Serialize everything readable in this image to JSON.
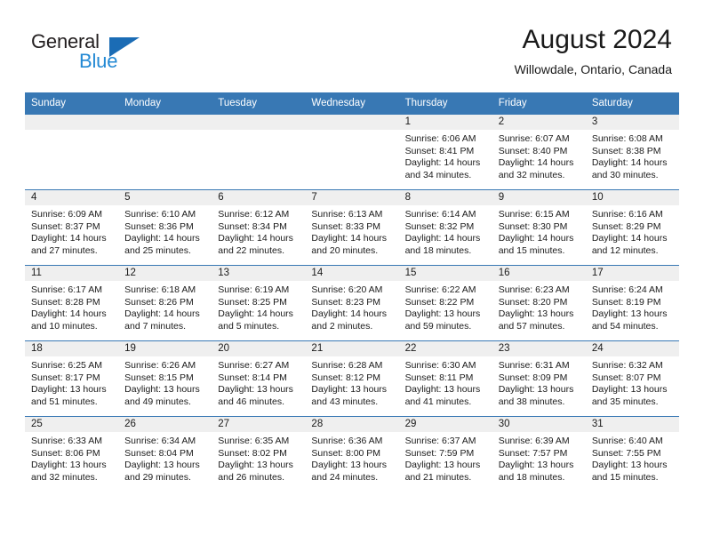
{
  "brand": {
    "name_top": "General",
    "name_bottom": "Blue",
    "triangle_color": "#1b6cb5",
    "blue_text_color": "#2389d4"
  },
  "header": {
    "title": "August 2024",
    "subtitle": "Willowdale, Ontario, Canada",
    "header_bg": "#3878b4",
    "header_text": "#ffffff"
  },
  "weekdays": [
    "Sunday",
    "Monday",
    "Tuesday",
    "Wednesday",
    "Thursday",
    "Friday",
    "Saturday"
  ],
  "labels": {
    "sunrise_prefix": "Sunrise:",
    "sunset_prefix": "Sunset:",
    "daylight_prefix": "Daylight:"
  },
  "weeks": [
    [
      {
        "day": "",
        "empty": true,
        "line1": "",
        "line2": "",
        "line3": "",
        "line4": ""
      },
      {
        "day": "",
        "empty": true,
        "line1": "",
        "line2": "",
        "line3": "",
        "line4": ""
      },
      {
        "day": "",
        "empty": true,
        "line1": "",
        "line2": "",
        "line3": "",
        "line4": ""
      },
      {
        "day": "",
        "empty": true,
        "line1": "",
        "line2": "",
        "line3": "",
        "line4": ""
      },
      {
        "day": "1",
        "empty": false,
        "line1": "Sunrise: 6:06 AM",
        "line2": "Sunset: 8:41 PM",
        "line3": "Daylight: 14 hours",
        "line4": "and 34 minutes."
      },
      {
        "day": "2",
        "empty": false,
        "line1": "Sunrise: 6:07 AM",
        "line2": "Sunset: 8:40 PM",
        "line3": "Daylight: 14 hours",
        "line4": "and 32 minutes."
      },
      {
        "day": "3",
        "empty": false,
        "line1": "Sunrise: 6:08 AM",
        "line2": "Sunset: 8:38 PM",
        "line3": "Daylight: 14 hours",
        "line4": "and 30 minutes."
      }
    ],
    [
      {
        "day": "4",
        "empty": false,
        "line1": "Sunrise: 6:09 AM",
        "line2": "Sunset: 8:37 PM",
        "line3": "Daylight: 14 hours",
        "line4": "and 27 minutes."
      },
      {
        "day": "5",
        "empty": false,
        "line1": "Sunrise: 6:10 AM",
        "line2": "Sunset: 8:36 PM",
        "line3": "Daylight: 14 hours",
        "line4": "and 25 minutes."
      },
      {
        "day": "6",
        "empty": false,
        "line1": "Sunrise: 6:12 AM",
        "line2": "Sunset: 8:34 PM",
        "line3": "Daylight: 14 hours",
        "line4": "and 22 minutes."
      },
      {
        "day": "7",
        "empty": false,
        "line1": "Sunrise: 6:13 AM",
        "line2": "Sunset: 8:33 PM",
        "line3": "Daylight: 14 hours",
        "line4": "and 20 minutes."
      },
      {
        "day": "8",
        "empty": false,
        "line1": "Sunrise: 6:14 AM",
        "line2": "Sunset: 8:32 PM",
        "line3": "Daylight: 14 hours",
        "line4": "and 18 minutes."
      },
      {
        "day": "9",
        "empty": false,
        "line1": "Sunrise: 6:15 AM",
        "line2": "Sunset: 8:30 PM",
        "line3": "Daylight: 14 hours",
        "line4": "and 15 minutes."
      },
      {
        "day": "10",
        "empty": false,
        "line1": "Sunrise: 6:16 AM",
        "line2": "Sunset: 8:29 PM",
        "line3": "Daylight: 14 hours",
        "line4": "and 12 minutes."
      }
    ],
    [
      {
        "day": "11",
        "empty": false,
        "line1": "Sunrise: 6:17 AM",
        "line2": "Sunset: 8:28 PM",
        "line3": "Daylight: 14 hours",
        "line4": "and 10 minutes."
      },
      {
        "day": "12",
        "empty": false,
        "line1": "Sunrise: 6:18 AM",
        "line2": "Sunset: 8:26 PM",
        "line3": "Daylight: 14 hours",
        "line4": "and 7 minutes."
      },
      {
        "day": "13",
        "empty": false,
        "line1": "Sunrise: 6:19 AM",
        "line2": "Sunset: 8:25 PM",
        "line3": "Daylight: 14 hours",
        "line4": "and 5 minutes."
      },
      {
        "day": "14",
        "empty": false,
        "line1": "Sunrise: 6:20 AM",
        "line2": "Sunset: 8:23 PM",
        "line3": "Daylight: 14 hours",
        "line4": "and 2 minutes."
      },
      {
        "day": "15",
        "empty": false,
        "line1": "Sunrise: 6:22 AM",
        "line2": "Sunset: 8:22 PM",
        "line3": "Daylight: 13 hours",
        "line4": "and 59 minutes."
      },
      {
        "day": "16",
        "empty": false,
        "line1": "Sunrise: 6:23 AM",
        "line2": "Sunset: 8:20 PM",
        "line3": "Daylight: 13 hours",
        "line4": "and 57 minutes."
      },
      {
        "day": "17",
        "empty": false,
        "line1": "Sunrise: 6:24 AM",
        "line2": "Sunset: 8:19 PM",
        "line3": "Daylight: 13 hours",
        "line4": "and 54 minutes."
      }
    ],
    [
      {
        "day": "18",
        "empty": false,
        "line1": "Sunrise: 6:25 AM",
        "line2": "Sunset: 8:17 PM",
        "line3": "Daylight: 13 hours",
        "line4": "and 51 minutes."
      },
      {
        "day": "19",
        "empty": false,
        "line1": "Sunrise: 6:26 AM",
        "line2": "Sunset: 8:15 PM",
        "line3": "Daylight: 13 hours",
        "line4": "and 49 minutes."
      },
      {
        "day": "20",
        "empty": false,
        "line1": "Sunrise: 6:27 AM",
        "line2": "Sunset: 8:14 PM",
        "line3": "Daylight: 13 hours",
        "line4": "and 46 minutes."
      },
      {
        "day": "21",
        "empty": false,
        "line1": "Sunrise: 6:28 AM",
        "line2": "Sunset: 8:12 PM",
        "line3": "Daylight: 13 hours",
        "line4": "and 43 minutes."
      },
      {
        "day": "22",
        "empty": false,
        "line1": "Sunrise: 6:30 AM",
        "line2": "Sunset: 8:11 PM",
        "line3": "Daylight: 13 hours",
        "line4": "and 41 minutes."
      },
      {
        "day": "23",
        "empty": false,
        "line1": "Sunrise: 6:31 AM",
        "line2": "Sunset: 8:09 PM",
        "line3": "Daylight: 13 hours",
        "line4": "and 38 minutes."
      },
      {
        "day": "24",
        "empty": false,
        "line1": "Sunrise: 6:32 AM",
        "line2": "Sunset: 8:07 PM",
        "line3": "Daylight: 13 hours",
        "line4": "and 35 minutes."
      }
    ],
    [
      {
        "day": "25",
        "empty": false,
        "line1": "Sunrise: 6:33 AM",
        "line2": "Sunset: 8:06 PM",
        "line3": "Daylight: 13 hours",
        "line4": "and 32 minutes."
      },
      {
        "day": "26",
        "empty": false,
        "line1": "Sunrise: 6:34 AM",
        "line2": "Sunset: 8:04 PM",
        "line3": "Daylight: 13 hours",
        "line4": "and 29 minutes."
      },
      {
        "day": "27",
        "empty": false,
        "line1": "Sunrise: 6:35 AM",
        "line2": "Sunset: 8:02 PM",
        "line3": "Daylight: 13 hours",
        "line4": "and 26 minutes."
      },
      {
        "day": "28",
        "empty": false,
        "line1": "Sunrise: 6:36 AM",
        "line2": "Sunset: 8:00 PM",
        "line3": "Daylight: 13 hours",
        "line4": "and 24 minutes."
      },
      {
        "day": "29",
        "empty": false,
        "line1": "Sunrise: 6:37 AM",
        "line2": "Sunset: 7:59 PM",
        "line3": "Daylight: 13 hours",
        "line4": "and 21 minutes."
      },
      {
        "day": "30",
        "empty": false,
        "line1": "Sunrise: 6:39 AM",
        "line2": "Sunset: 7:57 PM",
        "line3": "Daylight: 13 hours",
        "line4": "and 18 minutes."
      },
      {
        "day": "31",
        "empty": false,
        "line1": "Sunrise: 6:40 AM",
        "line2": "Sunset: 7:55 PM",
        "line3": "Daylight: 13 hours",
        "line4": "and 15 minutes."
      }
    ]
  ]
}
